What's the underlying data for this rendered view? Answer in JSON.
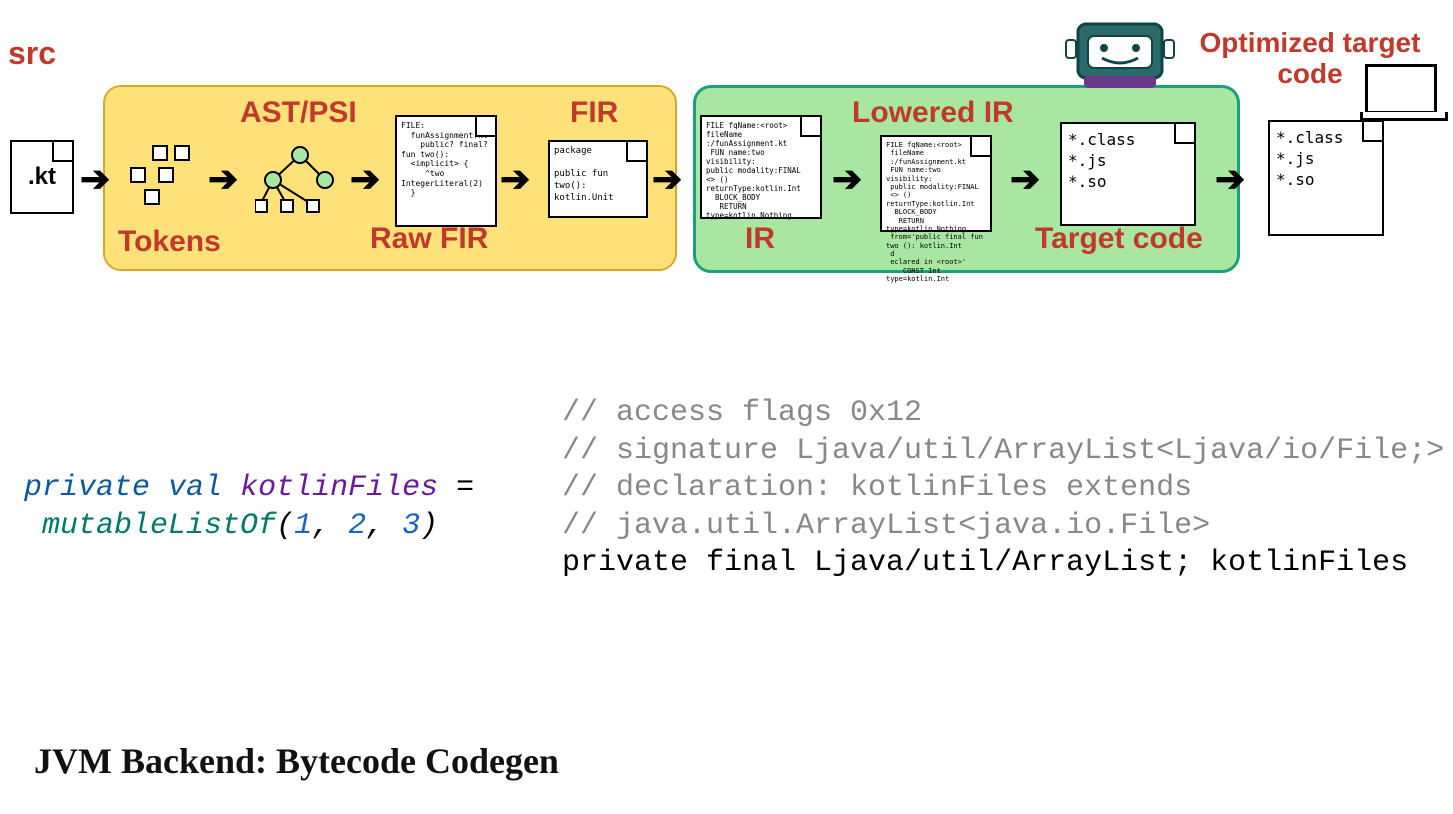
{
  "labels": {
    "src": "src",
    "tokens": "Tokens",
    "ast": "AST/PSI",
    "rawfir": "Raw FIR",
    "fir": "FIR",
    "ir": "IR",
    "lowered": "Lowered IR",
    "target": "Target code",
    "optimized": "Optimized target code"
  },
  "files": {
    "kt": ".kt",
    "rawfir": "FILE:\n  funAssignment.kt\n    public? final? fun two():\n  <implicit> {\n     ^two IntegerLiteral(2)\n  }",
    "fir": "package\n\npublic fun two():\nkotlin.Unit",
    "ir": "FILE fqName:<root>\nfileName\n:/funAssignment.kt\n FUN name:two visibility:\npublic modality:FINAL\n<> () returnType:kotlin.Int\n  BLOCK_BODY\n   RETURN\ntype=kotlin.Nothing",
    "lowered": "FILE fqName:<root>\n fileName\n :/funAssignment.kt\n FUN name:two visibility:\n public modality:FINAL\n <> () returnType:kotlin.Int\n  BLOCK_BODY\n   RETURN type=kotlin.Nothing\n from='public final fun two (): kotlin.Int\n d\n eclared in <root>'\n    CONST Int type=kotlin.Int",
    "target": "*.class\n*.js\n*.so",
    "optimized": "*.class\n*.js\n*.so"
  },
  "code_kotlin": {
    "kw1": "private",
    "kw2": "val",
    "name": "kotlinFiles",
    "eq": " =",
    "fn": "mutableListOf",
    "args_open": "(",
    "n1": "1",
    "n2": "2",
    "n3": "3",
    "comma": ", ",
    "args_close": ")"
  },
  "code_bytecode": {
    "l1": "// access flags 0x12",
    "l2": "// signature Ljava/util/ArrayList<Ljava/io/File;>",
    "l3": "// declaration: kotlinFiles extends",
    "l4": "// java.util.ArrayList<java.io.File>",
    "l5": "private final Ljava/util/ArrayList; kotlinFiles"
  },
  "footer": "JVM Backend: Bytecode Codegen"
}
